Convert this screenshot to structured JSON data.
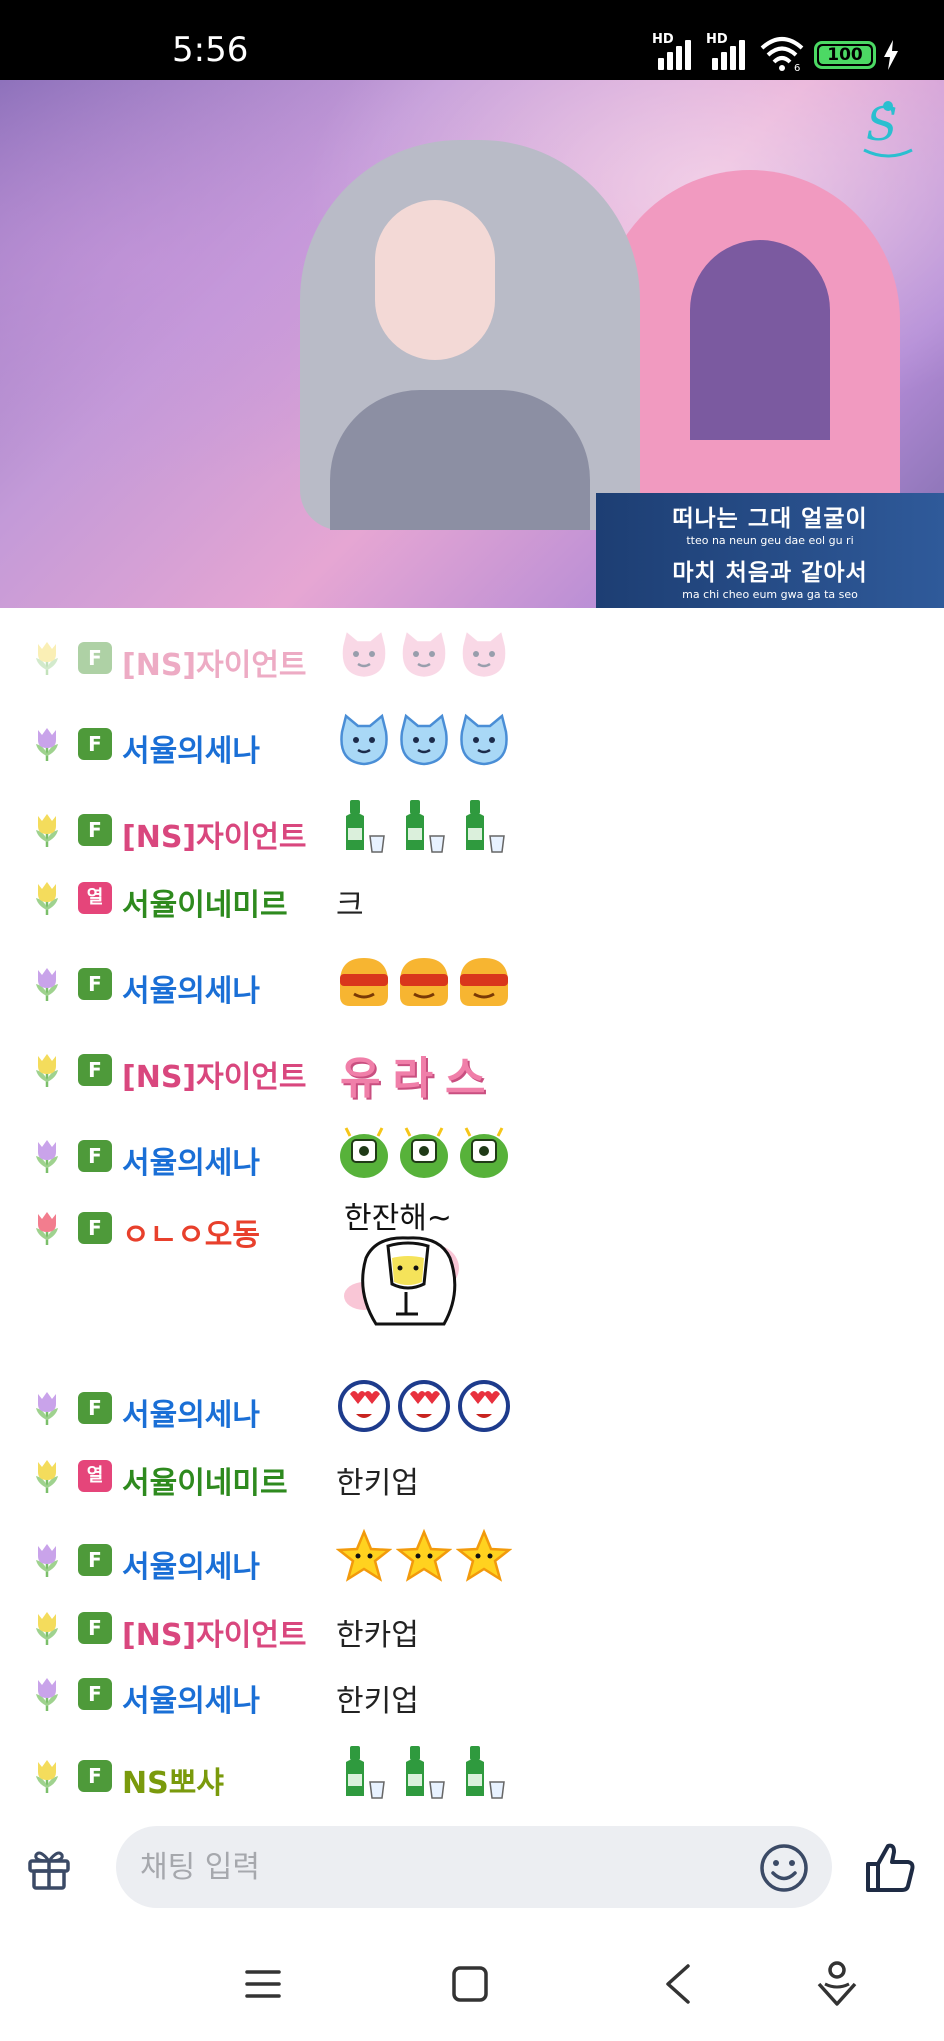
{
  "status_bar": {
    "time": "5:56",
    "signal1_label": "HD",
    "signal2_label": "HD",
    "wifi_label": "6",
    "battery": "100"
  },
  "video": {
    "lyrics": [
      {
        "text": "떠나는 그대 얼굴이",
        "romanization": "tteo na neun  geu dae  eol gu ri"
      },
      {
        "text": "마치 처음과 같아서",
        "romanization": "ma chi  cheo eum gwa  ga ta seo"
      }
    ]
  },
  "chat": {
    "messages": [
      {
        "flower": "yellow",
        "badge": "F",
        "nick": "[NS]자이언트",
        "nick_color": "#d9477e",
        "emote_name": "yuras-sticker",
        "faded": true
      },
      {
        "flower": "purple",
        "badge": "F",
        "nick": "서율의세나",
        "nick_color": "#1a6fd6",
        "emote_name": "blue-cat-sticker"
      },
      {
        "flower": "yellow",
        "badge": "F",
        "nick": "[NS]자이언트",
        "nick_color": "#d9477e",
        "emote_name": "soju-bottle-sticker"
      },
      {
        "flower": "yellow",
        "badge": "열",
        "nick": "서율이네미르",
        "nick_color": "#2e8a1e",
        "text": "크"
      },
      {
        "flower": "purple",
        "badge": "F",
        "nick": "서율의세나",
        "nick_color": "#1a6fd6",
        "emote_name": "cool-face-sticker"
      },
      {
        "flower": "yellow",
        "badge": "F",
        "nick": "[NS]자이언트",
        "nick_color": "#d9477e",
        "emote_text": "유라스"
      },
      {
        "flower": "purple",
        "badge": "F",
        "nick": "서율의세나",
        "nick_color": "#1a6fd6",
        "emote_name": "green-monster-sticker"
      },
      {
        "flower": "red",
        "badge": "F",
        "nick": "ㅇㄴㅇ오동",
        "nick_color": "#e8402c",
        "emote_text": "한잔해~"
      },
      {
        "flower": "purple",
        "badge": "F",
        "nick": "서율의세나",
        "nick_color": "#1a6fd6",
        "emote_name": "heart-eyes-sticker"
      },
      {
        "flower": "yellow",
        "badge": "열",
        "nick": "서율이네미르",
        "nick_color": "#2e8a1e",
        "text": "한키업"
      },
      {
        "flower": "purple",
        "badge": "F",
        "nick": "서율의세나",
        "nick_color": "#1a6fd6",
        "emote_name": "star-sticker"
      },
      {
        "flower": "yellow",
        "badge": "F",
        "nick": "[NS]자이언트",
        "nick_color": "#d9477e",
        "text": "한카업"
      },
      {
        "flower": "purple",
        "badge": "F",
        "nick": "서율의세나",
        "nick_color": "#1a6fd6",
        "text": "한키업"
      },
      {
        "flower": "yellow",
        "badge": "F",
        "nick": "NS뽀샤",
        "nick_color": "#7a9a0c",
        "emote_name": "soju-bottle-sticker"
      }
    ]
  },
  "input": {
    "placeholder": "채팅 입력",
    "gift_icon": "gift-icon",
    "emoji_icon": "emoji-icon",
    "like_icon": "thumbs-up-icon"
  },
  "nav": {
    "menu_icon": "menu-icon",
    "home_icon": "home-icon",
    "back_icon": "back-icon",
    "assist_icon": "assistant-icon"
  }
}
